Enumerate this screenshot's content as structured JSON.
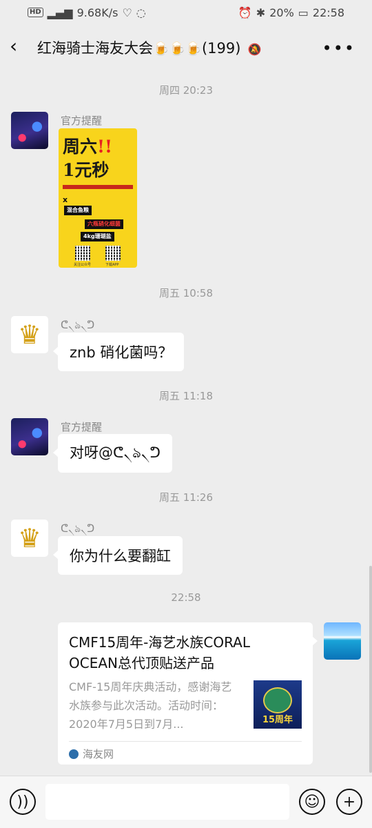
{
  "status": {
    "left": "9.68K/s",
    "battery": "20%",
    "time": "22:58"
  },
  "header": {
    "title": "红海骑士海友大会",
    "beer": "🍺🍺🍺",
    "count": "(199)"
  },
  "messages": {
    "t1": "周四 20:23",
    "nick_official": "官方提醒",
    "poster": {
      "line1": "周六",
      "excl": "!!",
      "line2": "1元秒",
      "x": "x",
      "tag1": "混合鱼粮",
      "tag2": "六瓶硝化细菌",
      "tag3": "4kg珊瑚盐",
      "small1": "关注公众号",
      "small2": "下载APP"
    },
    "t2": "周五 10:58",
    "nick_user": "ᕦ৲ঌ৲ᕤ",
    "msg1": "znb 硝化菌吗？",
    "t3": "周五 11:18",
    "msg2": "对呀@ᕦ৲ঌ৲ᕤ",
    "t4": "周五 11:26",
    "msg3": "你为什么要翻缸",
    "t5": "22:58",
    "card": {
      "title": "CMF15周年-海艺水族CORAL OCEAN总代顶贴送产品",
      "desc": "CMF-15周年庆典活动，感谢海艺水族参与此次活动。活动时间：2020年7月5日到7月...",
      "thumb_text": "15周年",
      "source": "海友网"
    }
  }
}
